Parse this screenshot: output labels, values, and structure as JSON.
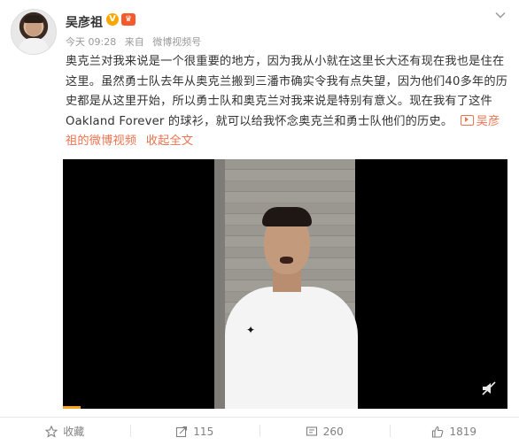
{
  "post": {
    "author": "吴彦祖",
    "verified_badge": "V",
    "vip_badge": "♛",
    "time": "今天 09:28",
    "source_prefix": "来自",
    "source": "微博视频号",
    "text_main": "奥克兰对我来说是一个很重要的地方，因为我从小就在这里长大还有现在我也是住在这里。虽然勇士队去年从奥克兰搬到三潘市确实令我有点失望，因为他们40多年的历史都是从这里开始，所以勇士队和奥克兰对我来说是特别有意义。现在我有了这件Oakland Forever 的球衫，就可以给我怀念奥克兰和勇士队他们的历史。",
    "video_link": "吴彦祖的微博视频",
    "collapse": "收起全文"
  },
  "video": {
    "progress": 0.04,
    "muted": true
  },
  "actions": {
    "favorite": "收藏",
    "repost": "115",
    "comment": "260",
    "like": "1819"
  },
  "colors": {
    "accent": "#eb7350",
    "meta": "#999999",
    "verified": "#f7a900"
  }
}
